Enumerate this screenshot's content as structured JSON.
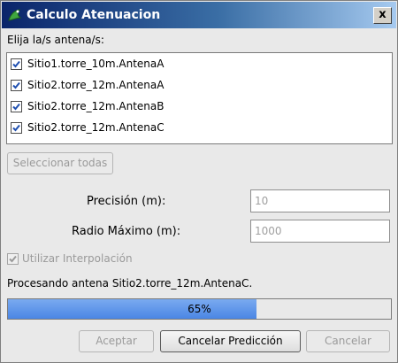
{
  "window": {
    "title": "Calculo Atenuacion",
    "close_label": "x",
    "icon": "green-frog-icon"
  },
  "antennas": {
    "label": "Elija la/s antena/s:",
    "items": [
      {
        "label": "Sitio1.torre_10m.AntenaA",
        "checked": true
      },
      {
        "label": "Sitio2.torre_12m.AntenaA",
        "checked": true
      },
      {
        "label": "Sitio2.torre_12m.AntenaB",
        "checked": true
      },
      {
        "label": "Sitio2.torre_12m.AntenaC",
        "checked": true
      }
    ],
    "select_all_label": "Seleccionar todas"
  },
  "params": {
    "precision_label": "Precisión (m):",
    "precision_value": "10",
    "radius_label": "Radio Máximo (m):",
    "radius_value": "1000",
    "interpolation_label": "Utilizar Interpolación",
    "interpolation_checked": true
  },
  "progress": {
    "status_text": "Procesando antena Sitio2.torre_12m.AntenaC.",
    "percent": 65,
    "percent_label": "65%"
  },
  "buttons": {
    "accept": "Aceptar",
    "cancel_prediction": "Cancelar Predicción",
    "cancel": "Cancelar"
  },
  "colors": {
    "progress_fill": "#4a86e4",
    "titlebar": "#0a246a"
  }
}
